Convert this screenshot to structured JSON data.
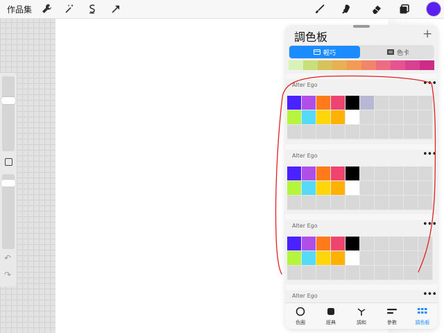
{
  "topbar": {
    "gallery_label": "作品集",
    "left_tools": [
      "wrench-icon",
      "magic-wand-icon",
      "selection-icon",
      "arrow-icon"
    ],
    "right_tools": [
      "brush-icon",
      "smudge-icon",
      "eraser-icon",
      "layers-icon"
    ],
    "current_color": "#5a1ef0"
  },
  "panel": {
    "title": "調色板",
    "plus": "+",
    "tabs": [
      {
        "label": "輕巧",
        "active": true
      },
      {
        "label": "色卡",
        "active": false
      }
    ],
    "strip_colors": [
      "#d8f2b8",
      "#c8e07a",
      "#d6c35e",
      "#e9b052",
      "#f39a54",
      "#f0856a",
      "#ec6c84",
      "#e65490",
      "#d8418f",
      "#cc2c88"
    ],
    "palettes": [
      {
        "name": "Alter Ego",
        "more": "•••",
        "colors": [
          "#4a22ff",
          "#b04ee8",
          "#ff7a18",
          "#ef4370",
          "#000000",
          "#b6b8d4",
          "",
          "",
          "",
          "",
          "#b6f53e",
          "#56daf8",
          "#ffd60a",
          "#ffb100",
          "#ffffff",
          "",
          "",
          "",
          "",
          ""
        ]
      },
      {
        "name": "Alter Ego",
        "more": "•••",
        "colors": [
          "#4a22ff",
          "#b04ee8",
          "#ff7a18",
          "#ef4370",
          "#000000",
          "",
          "",
          "",
          "",
          "",
          "#b6f53e",
          "#56daf8",
          "#ffd60a",
          "#ffb100",
          "#ffffff",
          "",
          "",
          "",
          "",
          ""
        ]
      },
      {
        "name": "Alter Ego",
        "more": "•••",
        "colors": [
          "#4a22ff",
          "#b04ee8",
          "#ff7a18",
          "#ef4370",
          "#000000",
          "",
          "",
          "",
          "",
          "",
          "#b6f53e",
          "#56daf8",
          "#ffd60a",
          "#ffb100",
          "#ffffff",
          "",
          "",
          "",
          "",
          ""
        ]
      },
      {
        "name": "Alter Ego",
        "more": "•••",
        "colors": []
      }
    ],
    "nav": [
      {
        "label": "色圈",
        "icon": "circle-icon",
        "active": false
      },
      {
        "label": "經典",
        "icon": "classic-square-icon",
        "active": false
      },
      {
        "label": "調和",
        "icon": "harmony-icon",
        "active": false
      },
      {
        "label": "參數",
        "icon": "value-sliders-icon",
        "active": false
      },
      {
        "label": "調色板",
        "icon": "palettes-grid-icon",
        "active": true
      }
    ]
  },
  "accent_color": "#1a8cff",
  "annotation_color": "#e0201f"
}
